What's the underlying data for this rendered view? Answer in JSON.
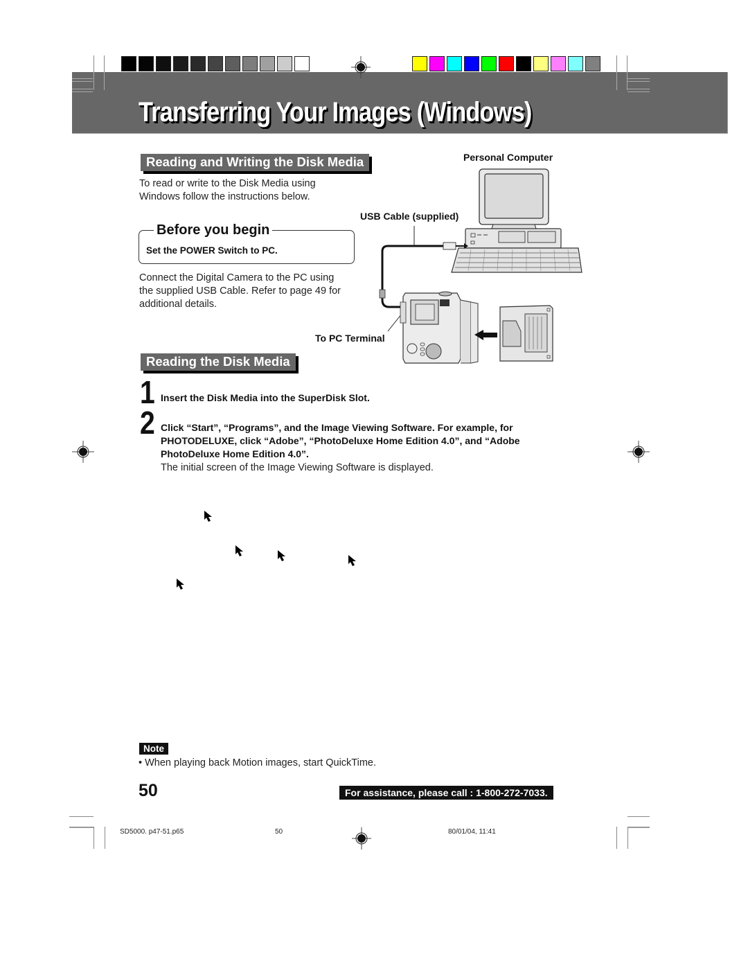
{
  "header": {
    "title": "Transferring Your Images (Windows)",
    "colors": {
      "banner": "#676767",
      "grayscale_swatches": [
        "#000000",
        "#050505",
        "#0f0f0f",
        "#1c1c1c",
        "#2a2a2a",
        "#444444",
        "#5e5e5e",
        "#7d7d7d",
        "#a0a0a0",
        "#cccccc",
        "#ffffff"
      ],
      "color_swatches": [
        "#ffff00",
        "#ff00ff",
        "#00ffff",
        "#0000ff",
        "#00ff00",
        "#ff0000",
        "#000000",
        "#ffff80",
        "#ff80ff",
        "#80ffff",
        "#808080"
      ]
    }
  },
  "section_rw": {
    "heading": "Reading and Writing the Disk Media",
    "intro": "To read or write to the Disk Media using Windows follow the instructions below."
  },
  "before_you_begin": {
    "title": "Before you begin",
    "instruction": "Set the POWER Switch to PC."
  },
  "connect_text": "Connect the Digital Camera to the PC using the supplied USB Cable. Refer to page 49 for additional details.",
  "diagram": {
    "label_pc": "Personal Computer",
    "label_usb": "USB Cable (supplied)",
    "label_terminal": "To PC Terminal",
    "icons": [
      "computer-monitor-icon",
      "keyboard-icon",
      "usb-plug-icon",
      "digital-camera-icon",
      "superdisk-icon",
      "insert-arrow-icon"
    ]
  },
  "section_read": {
    "heading": "Reading the Disk Media",
    "steps": [
      {
        "num": "1",
        "text": "Insert the Disk Media into the SuperDisk Slot."
      },
      {
        "num": "2",
        "text": "Click “Start”, “Programs”, and the Image Viewing Software. For example, for PHOTODELUXE, click “Adobe”, “PhotoDeluxe Home Edition 4.0”, and “Adobe PhotoDeluxe Home Edition 4.0”.",
        "subtext": "The initial screen of the Image Viewing Software is displayed."
      }
    ]
  },
  "cursor_icons": [
    "cursor-arrow-icon",
    "cursor-arrow-icon",
    "cursor-arrow-icon",
    "cursor-arrow-icon",
    "cursor-arrow-icon"
  ],
  "note": {
    "label": "Note",
    "text": "• When playing back Motion images, start QuickTime."
  },
  "footer": {
    "page_number": "50",
    "assistance": "For assistance, please call : 1-800-272-7033.",
    "slug_file": "SD5000. p47-51.p65",
    "slug_page": "50",
    "slug_date": "80/01/04, 11:41"
  }
}
